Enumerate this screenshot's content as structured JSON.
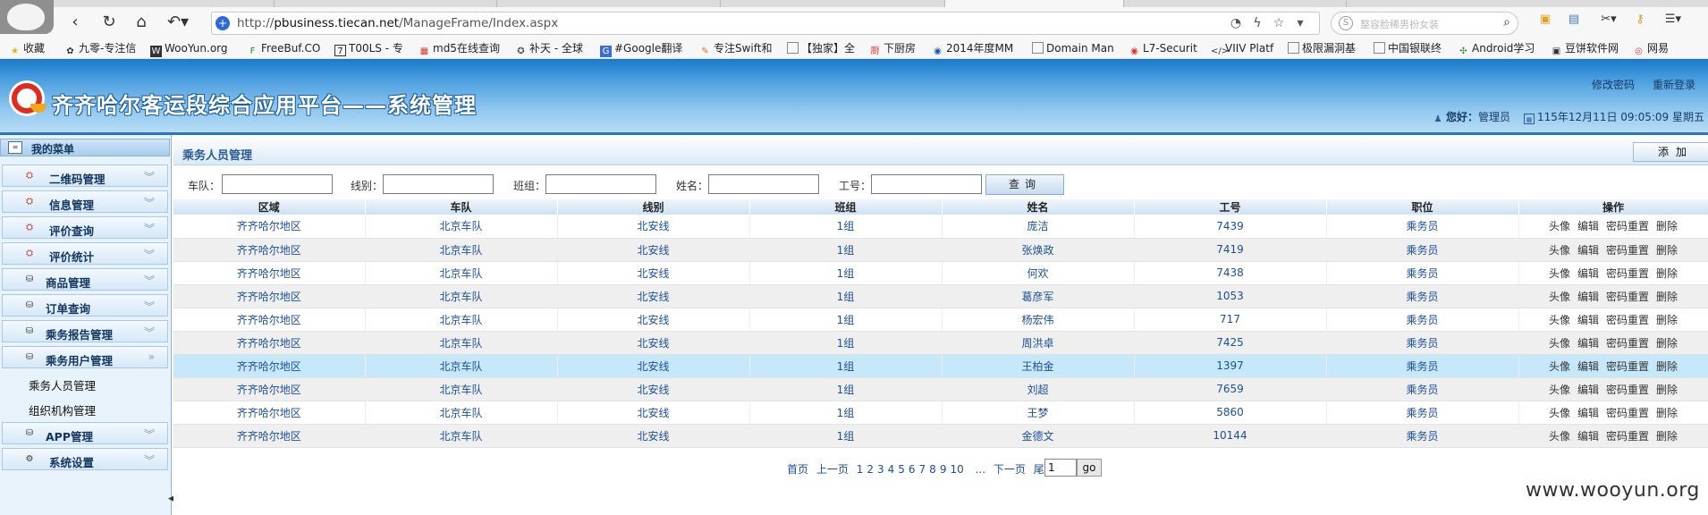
{
  "browser": {
    "url_prefix": "http://",
    "url_host": "pbusiness.tiecan.net",
    "url_path": "/ManageFrame/Index.aspx",
    "search_placeholder": "整容脸稀男扮女装",
    "bookmarks": [
      "收藏",
      "九零-专注信",
      "WooYun.org",
      "FreeBuf.CO",
      "T00LS - 专",
      "md5在线查询",
      "补天 - 全球",
      "#Google翻译",
      "专注Swift和",
      "【独家】全",
      "下厨房",
      "2014年度MM",
      "Domain Man",
      "L7-Securit",
      "VIIV Platf",
      "极限漏洞基",
      "中国银联终",
      "Android学习",
      "豆饼软件网",
      "网易"
    ]
  },
  "header": {
    "app_title": "齐齐哈尔客运段综合应用平台——系统管理",
    "change_password": "修改密码",
    "relogin": "重新登录",
    "greeting": "您好：",
    "username": "管理员",
    "datetime": "115年12月11日 09:05:09 星期五"
  },
  "sidebar": {
    "title": "我的菜单",
    "items": [
      {
        "label": "二维码管理"
      },
      {
        "label": "信息管理"
      },
      {
        "label": "评价查询"
      },
      {
        "label": "评价统计"
      },
      {
        "label": "商品管理"
      },
      {
        "label": "订单查询"
      },
      {
        "label": "乘务报告管理"
      },
      {
        "label": "乘务用户管理"
      },
      {
        "label": "APP管理"
      },
      {
        "label": "系统设置"
      }
    ],
    "subitems": [
      "乘务人员管理",
      "组织机构管理"
    ]
  },
  "main": {
    "page_title": "乘务人员管理",
    "add_button": "添加",
    "filters": {
      "team": "车队：",
      "line": "线别：",
      "group": "班组：",
      "name": "姓名：",
      "id": "工号："
    },
    "query_button": "查询",
    "columns": [
      "区域",
      "车队",
      "线别",
      "班组",
      "姓名",
      "工号",
      "职位",
      "操作"
    ],
    "actions": [
      "头像",
      "编辑",
      "密码重置",
      "删除"
    ],
    "rows": [
      [
        "齐齐哈尔地区",
        "北京车队",
        "北安线",
        "1组",
        "庞洁",
        "7439",
        "乘务员"
      ],
      [
        "齐齐哈尔地区",
        "北京车队",
        "北安线",
        "1组",
        "张焕政",
        "7419",
        "乘务员"
      ],
      [
        "齐齐哈尔地区",
        "北京车队",
        "北安线",
        "1组",
        "何欢",
        "7438",
        "乘务员"
      ],
      [
        "齐齐哈尔地区",
        "北京车队",
        "北安线",
        "1组",
        "葛彦军",
        "1053",
        "乘务员"
      ],
      [
        "齐齐哈尔地区",
        "北京车队",
        "北安线",
        "1组",
        "杨宏伟",
        "717",
        "乘务员"
      ],
      [
        "齐齐哈尔地区",
        "北京车队",
        "北安线",
        "1组",
        "周洪卓",
        "7425",
        "乘务员"
      ],
      [
        "齐齐哈尔地区",
        "北京车队",
        "北安线",
        "1组",
        "王柏金",
        "1397",
        "乘务员"
      ],
      [
        "齐齐哈尔地区",
        "北京车队",
        "北安线",
        "1组",
        "刘超",
        "7659",
        "乘务员"
      ],
      [
        "齐齐哈尔地区",
        "北京车队",
        "北安线",
        "1组",
        "王梦",
        "5860",
        "乘务员"
      ],
      [
        "齐齐哈尔地区",
        "北京车队",
        "北安线",
        "1组",
        "金德文",
        "10144",
        "乘务员"
      ]
    ],
    "pager": {
      "first": "首页",
      "prev": "上一页",
      "pages": [
        "1",
        "2",
        "3",
        "4",
        "5",
        "6",
        "7",
        "8",
        "9",
        "10"
      ],
      "ellipsis": "...",
      "next": "下一页",
      "last": "尾页",
      "current": "1",
      "go": "go"
    }
  },
  "watermark": "www.wooyun.org",
  "colors": {
    "header_blue": "#3f97dc",
    "link_blue": "#1d4f96",
    "selected_row": "#c7e8fb"
  }
}
